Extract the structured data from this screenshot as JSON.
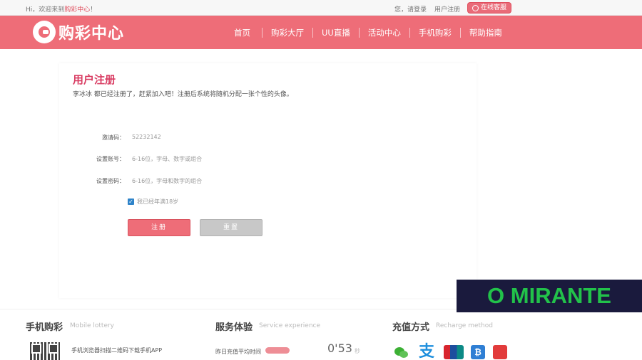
{
  "topbar": {
    "welcome_prefix": "Hi，欢迎来到",
    "welcome_brand": "购彩中心",
    "welcome_suffix": "！",
    "login_link": "您，请登录",
    "register_link": "用户注册",
    "customer_service": "在线客服"
  },
  "header": {
    "logo_text": "购彩中心",
    "nav": [
      {
        "label": "首页"
      },
      {
        "label": "购彩大厅"
      },
      {
        "label": "UU直播"
      },
      {
        "label": "活动中心"
      },
      {
        "label": "手机购彩"
      },
      {
        "label": "帮助指南"
      }
    ]
  },
  "register": {
    "title": "用户注册",
    "intro": "李冰冰 都已经注册了，赶紧加入吧！注册后系统将随机分配一张个性的头像。",
    "fields": [
      {
        "label": "邀请码：",
        "value": "52232142"
      },
      {
        "label": "设置账号：",
        "placeholder": "6-16位，字母、数字或组合"
      },
      {
        "label": "设置密码：",
        "placeholder": "6-16位，字母和数字的组合"
      }
    ],
    "age_check": "我已经年满18岁",
    "submit": "注册",
    "reset": "重置"
  },
  "watermark": "O MIRANTE",
  "footer": {
    "mobile": {
      "title": "手机购彩",
      "subtitle": "Mobile lottery",
      "text": "手机浏览器扫描二维码下载手机APP"
    },
    "service": {
      "title": "服务体验",
      "subtitle": "Service experience",
      "label": "昨日充值平均时间",
      "time": "0'53",
      "unit": "秒"
    },
    "recharge": {
      "title": "充值方式",
      "subtitle": "Recharge method",
      "alipay_glyph": "支",
      "bitcoin_glyph": "₿"
    }
  }
}
